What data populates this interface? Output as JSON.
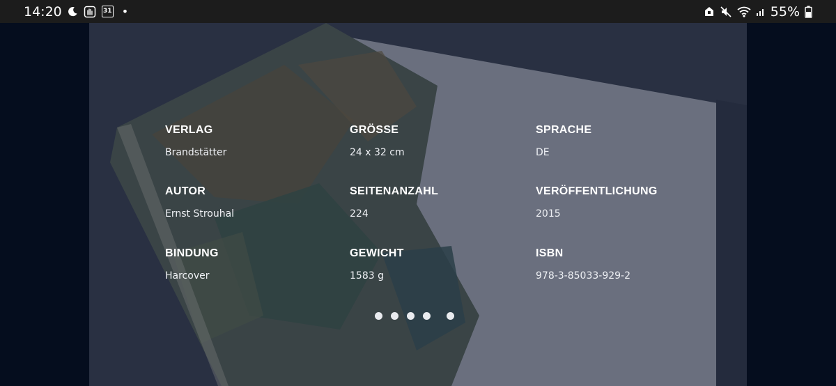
{
  "status_bar": {
    "time": "14:20",
    "calendar_day": "31",
    "notification_dot": "•",
    "battery_percent": "55%",
    "icons": [
      "moon-icon",
      "hand-icon",
      "calendar-icon",
      "lock-house-icon",
      "mute-icon",
      "wifi-icon",
      "signal-icon",
      "battery-icon"
    ]
  },
  "details": {
    "verlag": {
      "label": "VERLAG",
      "value": "Brandstätter"
    },
    "groesse": {
      "label": "GRÖSSE",
      "value": "24 x 32 cm"
    },
    "sprache": {
      "label": "SPRACHE",
      "value": "DE"
    },
    "autor": {
      "label": "AUTOR",
      "value": "Ernst Strouhal"
    },
    "seitenanzahl": {
      "label": "SEITENANZAHL",
      "value": "224"
    },
    "veroeffentlichung": {
      "label": "VERÖFFENTLICHUNG",
      "value": "2015"
    },
    "bindung": {
      "label": "BINDUNG",
      "value": "Harcover"
    },
    "gewicht": {
      "label": "GEWICHT",
      "value": "1583 g"
    },
    "isbn": {
      "label": "ISBN",
      "value": "978-3-85033-929-2"
    }
  },
  "carousel": {
    "page_count": 5
  },
  "colors": {
    "status_bar_bg": "#1c1c1c",
    "side_panel_bg": "#050d1e",
    "overlay": "#1c243a",
    "text": "#ffffff"
  }
}
